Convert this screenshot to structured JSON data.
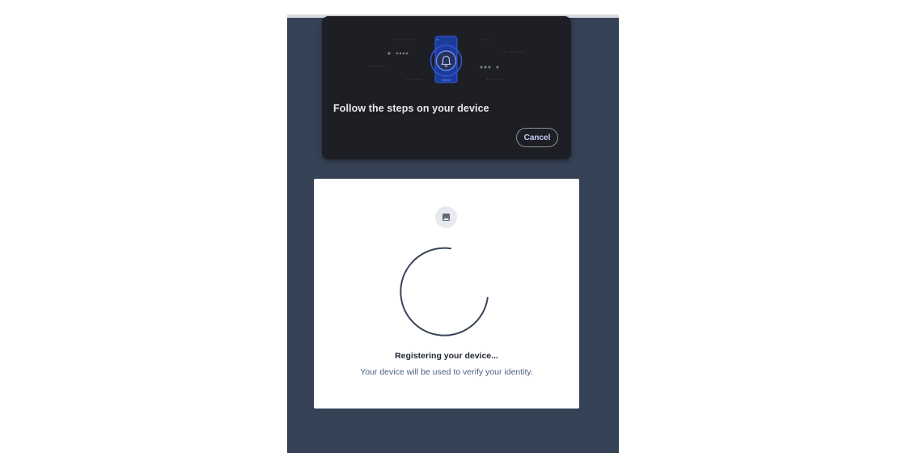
{
  "dialog": {
    "title": "Follow the steps on your device",
    "cancel_label": "Cancel",
    "illustration_icon": "bell-icon",
    "accent_color": "#2d54d4"
  },
  "card": {
    "status_title": "Registering your device...",
    "status_subtitle": "Your device will be used to verify your identity.",
    "badge_icon": "image-icon"
  },
  "colors": {
    "panel_background": "#354155",
    "dialog_background": "#1e1f24",
    "card_background": "#ffffff",
    "spinner": "#3a4558"
  }
}
